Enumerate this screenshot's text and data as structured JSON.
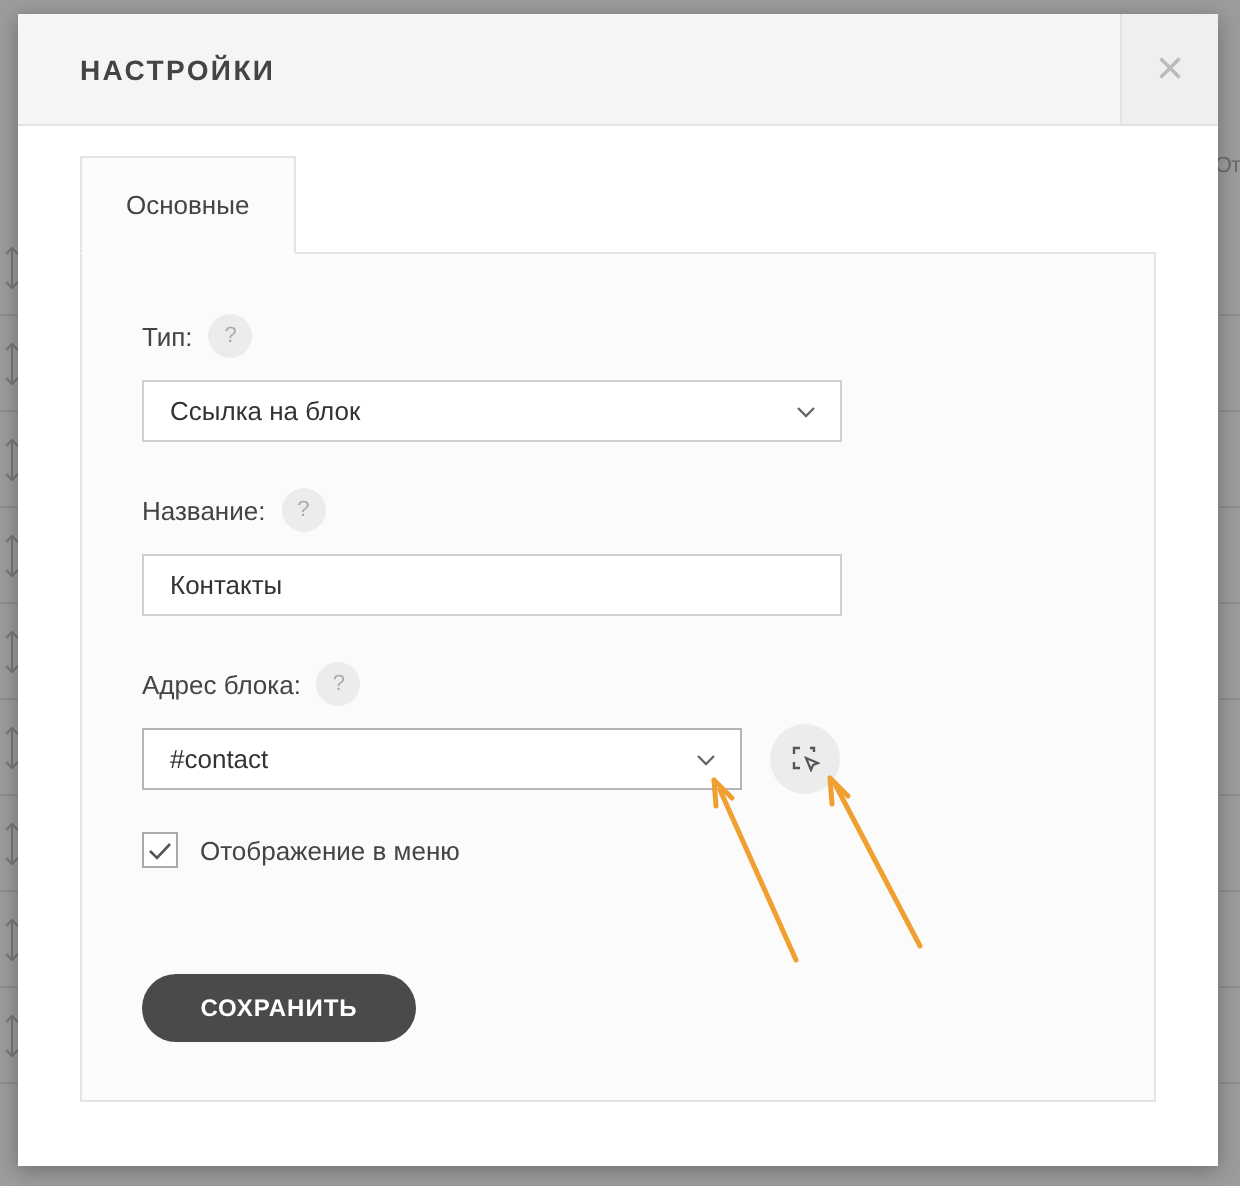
{
  "background": {
    "partial_text": "От"
  },
  "dialog": {
    "title": "НАСТРОЙКИ",
    "close": "×"
  },
  "tabs": [
    {
      "label": "Основные",
      "selected": true
    }
  ],
  "fields": [
    {
      "kind": "select",
      "label": "Тип:",
      "help": "?",
      "value": "Ссылка на блок"
    },
    {
      "kind": "input",
      "label": "Название:",
      "help": "?",
      "value": "Контакты"
    },
    {
      "kind": "select-pick",
      "label": "Адрес блока:",
      "help": "?",
      "value": "#contact"
    }
  ],
  "checkbox": {
    "label": "Отображение в меню",
    "checked": true
  },
  "save_button": "СОХРАНИТЬ"
}
